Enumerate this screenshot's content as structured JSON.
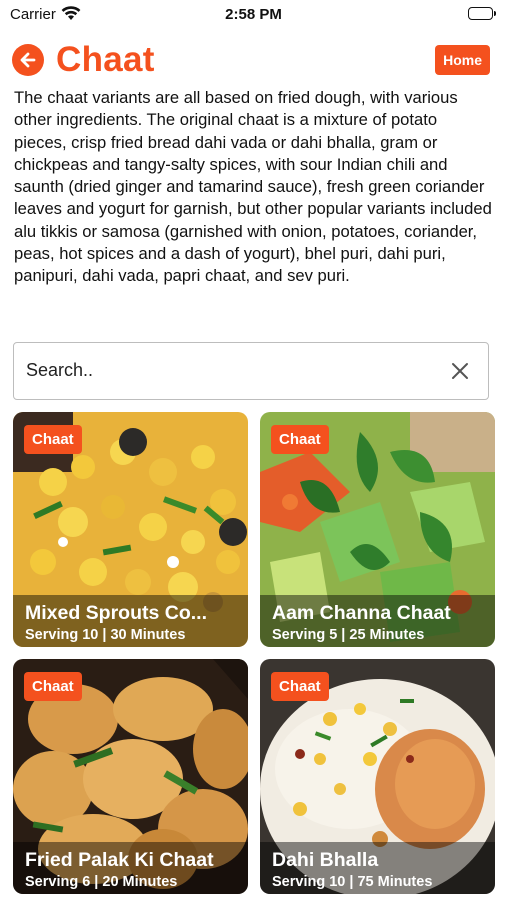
{
  "status_bar": {
    "carrier": "Carrier",
    "time": "2:58 PM",
    "icons": [
      "wifi-icon",
      "battery-icon"
    ]
  },
  "header": {
    "title": "Chaat",
    "back_icon": "arrow-left-icon",
    "home_label": "Home"
  },
  "description": "The chaat variants are all based on fried dough, with various other ingredients. The original chaat is a mixture of potato pieces, crisp fried bread dahi vada or dahi bhalla, gram or chickpeas and tangy-salty spices, with sour Indian chili and saunth (dried ginger and tamarind sauce), fresh green coriander leaves and yogurt for garnish, but other popular variants included alu tikkis or samosa (garnished with onion, potatoes, coriander, peas, hot spices and a dash of yogurt), bhel puri, dahi puri, panipuri, dahi vada, papri chaat, and sev puri.",
  "search": {
    "placeholder": "Search..",
    "value": "",
    "clear_icon": "close-icon"
  },
  "recipes": [
    {
      "badge": "Chaat",
      "title": "Mixed Sprouts Co...",
      "meta": "Serving 10 | 30 Minutes"
    },
    {
      "badge": "Chaat",
      "title": "Aam Channa Chaat",
      "meta": "Serving 5 | 25 Minutes"
    },
    {
      "badge": "Chaat",
      "title": "Fried Palak Ki Chaat",
      "meta": "Serving 6 | 20 Minutes"
    },
    {
      "badge": "Chaat",
      "title": "Dahi Bhalla",
      "meta": "Serving 10 | 75 Minutes"
    }
  ],
  "colors": {
    "accent": "#f4511e",
    "text": "#111111",
    "border": "#bdbdbd"
  }
}
